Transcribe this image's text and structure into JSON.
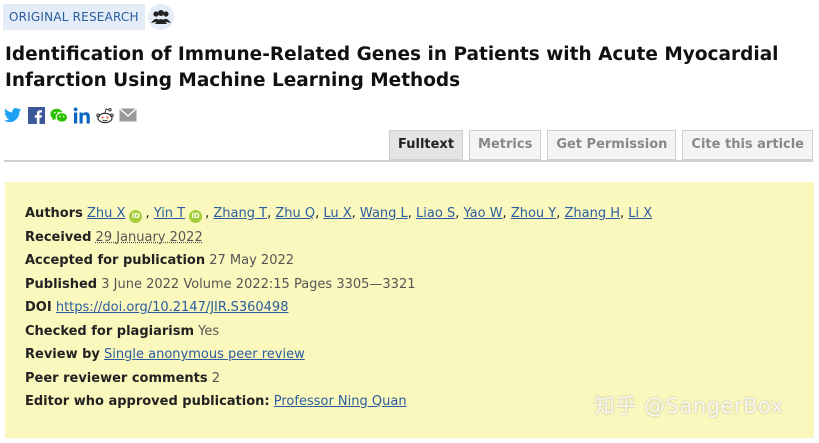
{
  "header": {
    "category_tag": "ORIGINAL RESEARCH",
    "title": "Identification of Immune-Related Genes in Patients with Acute Myocardial Infarction Using Machine Learning Methods"
  },
  "share_icons": [
    "twitter-icon",
    "facebook-icon",
    "wechat-icon",
    "linkedin-icon",
    "reddit-icon",
    "email-icon"
  ],
  "tabs": [
    {
      "label": "Fulltext",
      "active": true
    },
    {
      "label": "Metrics",
      "active": false
    },
    {
      "label": "Get Permission",
      "active": false
    },
    {
      "label": "Cite this article",
      "active": false
    }
  ],
  "meta": {
    "authors_label": "Authors",
    "authors": [
      "Zhu X",
      "Yin T",
      "Zhang T",
      "Zhu Q",
      "Lu X",
      "Wang L",
      "Liao S",
      "Yao W",
      "Zhou Y",
      "Zhang H",
      "Li X"
    ],
    "received_label": "Received",
    "received": "29 January 2022",
    "accepted_label": "Accepted for publication",
    "accepted": "27 May 2022",
    "published_label": "Published",
    "published": "3 June 2022 Volume 2022:15 Pages 3305—3321",
    "doi_label": "DOI",
    "doi": "https://doi.org/10.2147/JIR.S360498",
    "plagiarism_label": "Checked for plagiarism",
    "plagiarism": "Yes",
    "review_label": "Review by",
    "review": "Single anonymous peer review",
    "comments_label": "Peer reviewer comments",
    "comments": "2",
    "editor_label": "Editor who approved publication:",
    "editor": "Professor Ning Quan"
  },
  "watermark": "知乎 @SangerBox",
  "colors": {
    "accent": "#2a5d9f",
    "meta_background": "#fbf8bd",
    "tag_background": "#e3ecf7",
    "orcid": "#a6ce39"
  }
}
